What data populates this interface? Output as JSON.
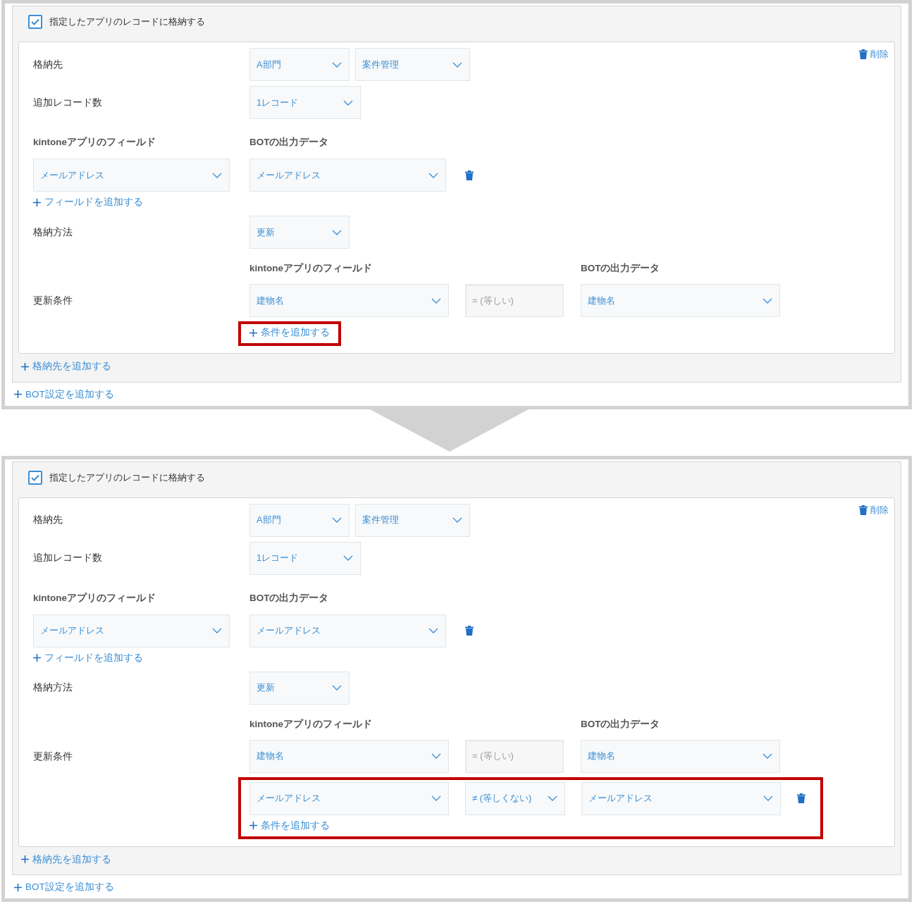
{
  "frames": [
    {
      "store_option": {
        "label": "指定したアプリのレコードに格納する",
        "checked": true
      },
      "delete_label": "削除",
      "destination": {
        "label": "格納先",
        "selects": [
          "A部門",
          "案件管理"
        ]
      },
      "record_count": {
        "label": "追加レコード数",
        "value": "1レコード"
      },
      "mapping": {
        "kintone_header": "kintoneアプリのフィールド",
        "bot_header": "BOTの出力データ",
        "rows": [
          {
            "field": "メールアドレス",
            "bot": "メールアドレス",
            "removable": true
          }
        ],
        "add_label": "フィールドを追加する"
      },
      "method": {
        "label": "格納方法",
        "value": "更新"
      },
      "conditions": {
        "label": "更新条件",
        "kintone_header": "kintoneアプリのフィールド",
        "bot_header": "BOTの出力データ",
        "rows": [
          {
            "field": "建物名",
            "operator": "= (等しい)",
            "kind": "fixed",
            "bot": "建物名",
            "removable": false,
            "highlighted": false
          }
        ],
        "add_label": "条件を追加する",
        "add_highlighted": true
      },
      "add_destination": "格納先を追加する",
      "add_bot": "BOT設定を追加する"
    },
    {
      "store_option": {
        "label": "指定したアプリのレコードに格納する",
        "checked": true
      },
      "delete_label": "削除",
      "destination": {
        "label": "格納先",
        "selects": [
          "A部門",
          "案件管理"
        ]
      },
      "record_count": {
        "label": "追加レコード数",
        "value": "1レコード"
      },
      "mapping": {
        "kintone_header": "kintoneアプリのフィールド",
        "bot_header": "BOTの出力データ",
        "rows": [
          {
            "field": "メールアドレス",
            "bot": "メールアドレス",
            "removable": true
          }
        ],
        "add_label": "フィールドを追加する"
      },
      "method": {
        "label": "格納方法",
        "value": "更新"
      },
      "conditions": {
        "label": "更新条件",
        "kintone_header": "kintoneアプリのフィールド",
        "bot_header": "BOTの出力データ",
        "rows": [
          {
            "field": "建物名",
            "operator": "= (等しい)",
            "kind": "fixed",
            "bot": "建物名",
            "removable": false,
            "highlighted": false
          },
          {
            "field": "メールアドレス",
            "operator": "≠ (等しくない)",
            "kind": "dropdown",
            "bot": "メールアドレス",
            "removable": true,
            "highlighted": true
          }
        ],
        "add_label": "条件を追加する",
        "add_highlighted": true
      },
      "add_destination": "格納先を追加する",
      "add_bot": "BOT設定を追加する"
    }
  ]
}
